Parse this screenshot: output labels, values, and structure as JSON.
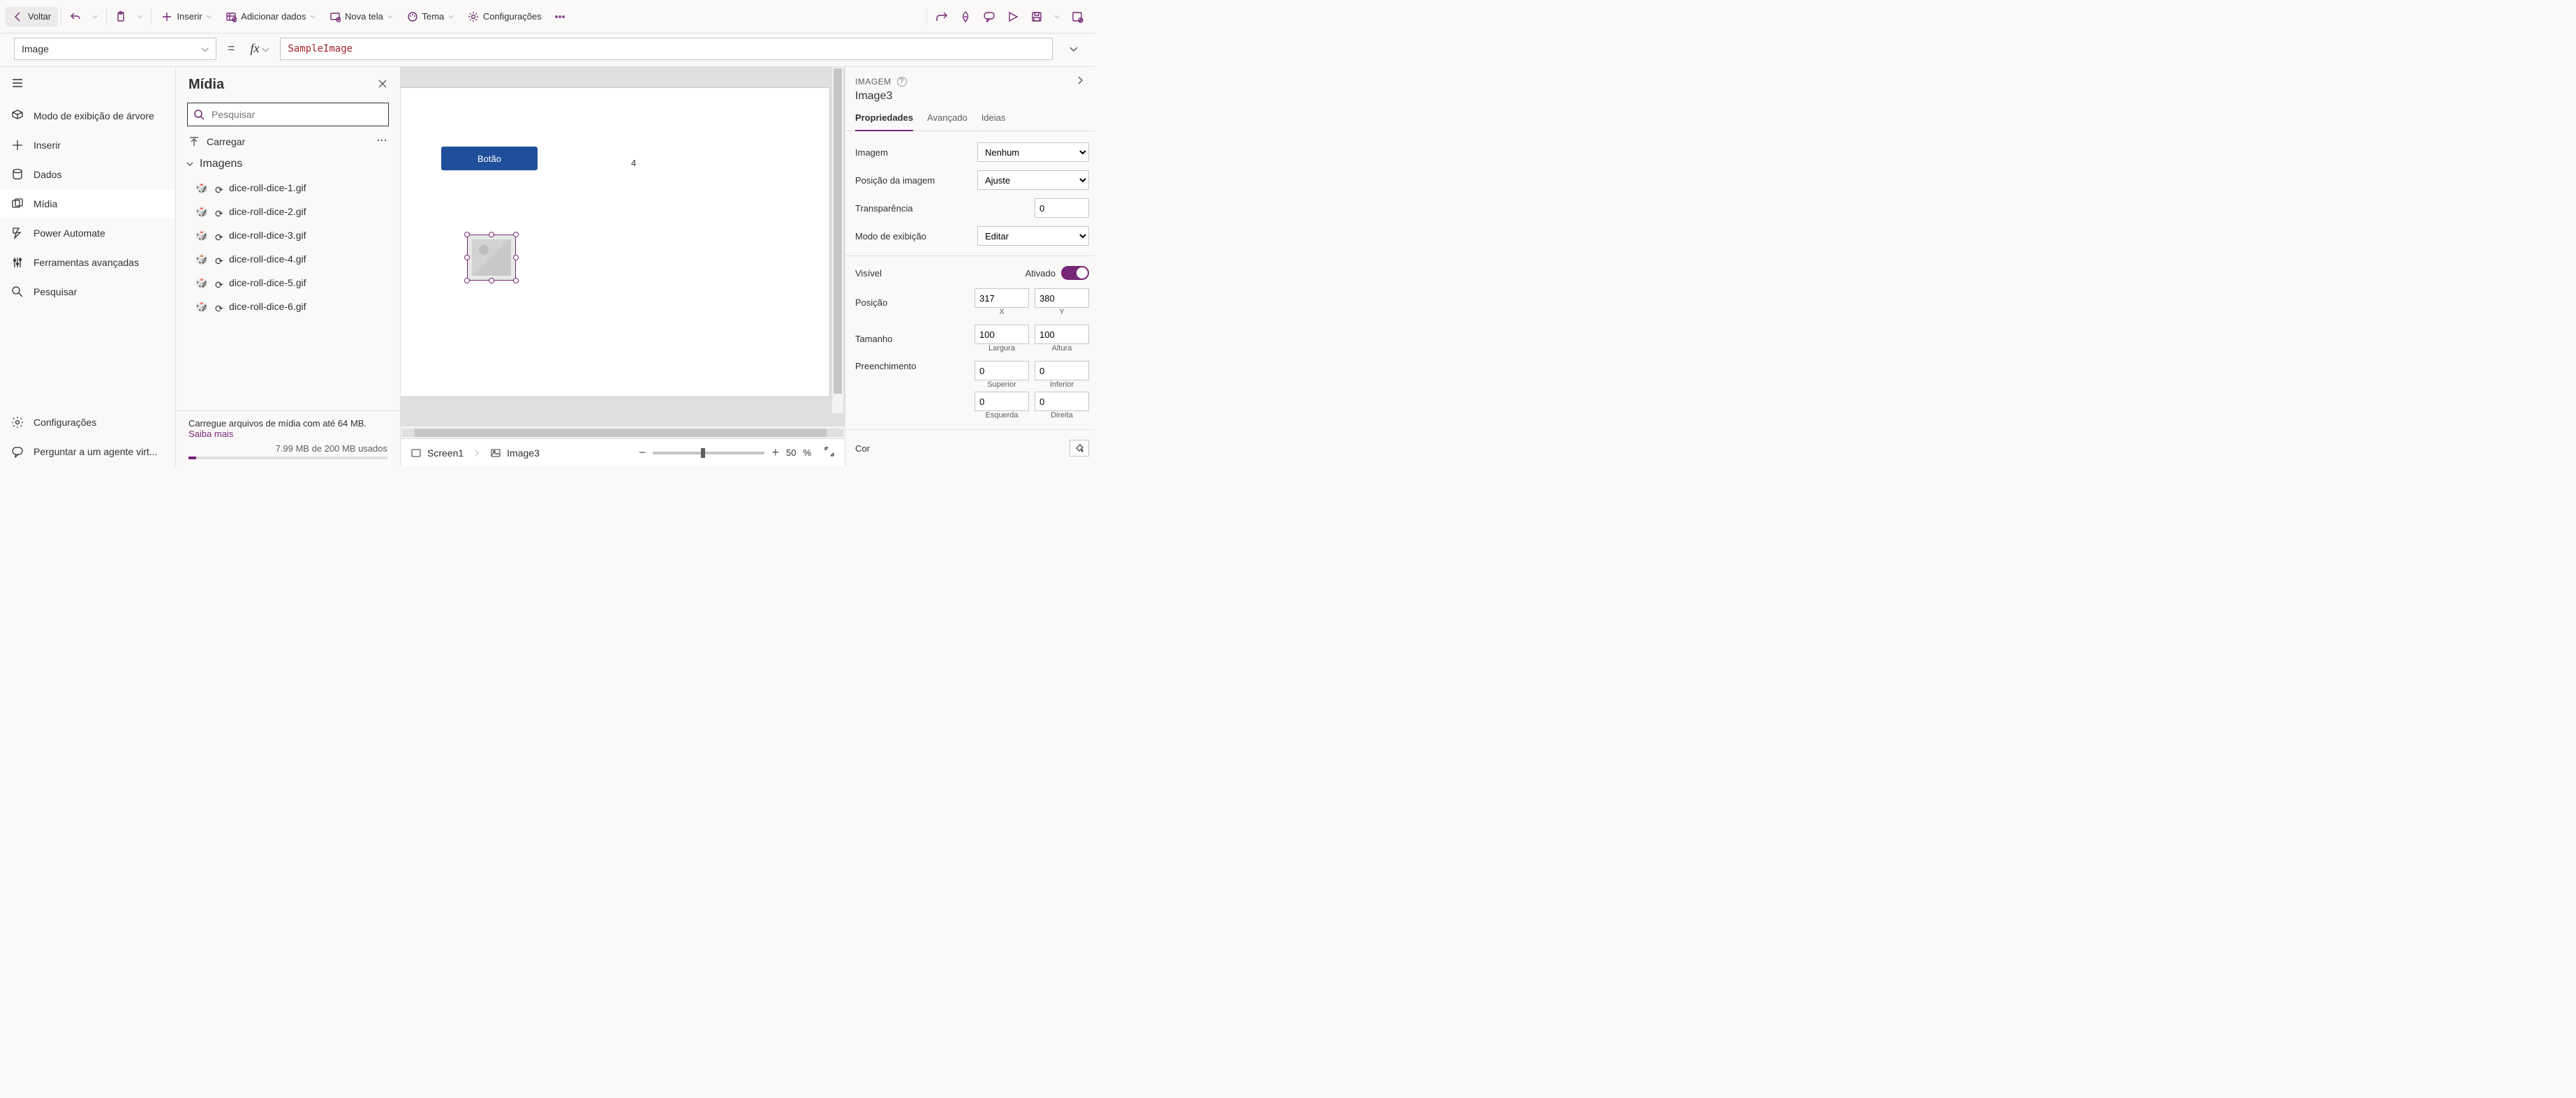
{
  "topbar": {
    "back": "Voltar",
    "insert": "Inserir",
    "add_data": "Adicionar dados",
    "new_screen": "Nova tela",
    "theme": "Tema",
    "settings": "Configurações"
  },
  "formula_bar": {
    "property": "Image",
    "expression": "SampleImage"
  },
  "leftrail": {
    "tree_view": "Modo de exibição de árvore",
    "insert": "Inserir",
    "data": "Dados",
    "media": "Mídia",
    "power_automate": "Power Automate",
    "adv_tools": "Ferramentas avançadas",
    "search": "Pesquisar",
    "settings": "Configurações",
    "ask_agent": "Perguntar a um agente virt..."
  },
  "mediapane": {
    "title": "Mídia",
    "search_placeholder": "Pesquisar",
    "upload": "Carregar",
    "group_images": "Imagens",
    "files": [
      "dice-roll-dice-1.gif",
      "dice-roll-dice-2.gif",
      "dice-roll-dice-3.gif",
      "dice-roll-dice-4.gif",
      "dice-roll-dice-5.gif",
      "dice-roll-dice-6.gif"
    ],
    "footer_line": "Carregue arquivos de mídia com até 64 MB.",
    "learn_more": "Saiba mais",
    "quota": "7.99 MB de 200 MB usados"
  },
  "canvas": {
    "button_label": "Botão",
    "label_text": "4",
    "breadcrumb_screen": "Screen1",
    "breadcrumb_control": "Image3",
    "zoom_value": "50",
    "zoom_unit": "%"
  },
  "proppane": {
    "header": "IMAGEM",
    "name": "Image3",
    "tabs": {
      "props": "Propriedades",
      "advanced": "Avançado",
      "ideas": "Ideias"
    },
    "rows": {
      "image": {
        "label": "Imagem",
        "value": "Nenhum"
      },
      "image_position": {
        "label": "Posição da imagem",
        "value": "Ajuste"
      },
      "transparency": {
        "label": "Transparência",
        "value": "0"
      },
      "display_mode": {
        "label": "Modo de exibição",
        "value": "Editar"
      },
      "visible": {
        "label": "Visível",
        "state_label": "Ativado"
      },
      "position": {
        "label": "Posição",
        "x": "317",
        "y": "380",
        "x_sub": "X",
        "y_sub": "Y"
      },
      "size": {
        "label": "Tamanho",
        "w": "100",
        "h": "100",
        "w_sub": "Largura",
        "h_sub": "Altura"
      },
      "padding": {
        "label": "Preenchimento",
        "top": "0",
        "bottom": "0",
        "left": "0",
        "right": "0",
        "top_sub": "Superior",
        "bottom_sub": "Inferior",
        "left_sub": "Esquerda",
        "right_sub": "Direita"
      },
      "color": {
        "label": "Cor"
      }
    }
  }
}
